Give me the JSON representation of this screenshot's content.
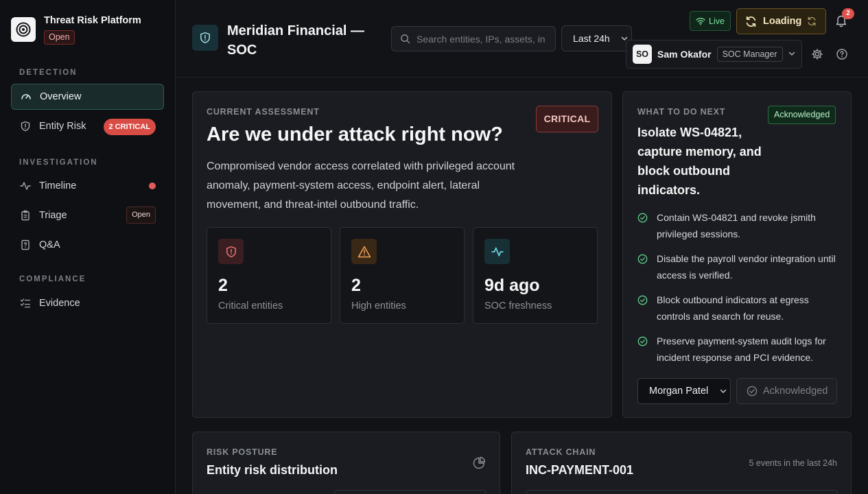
{
  "brand": {
    "title": "Threat Risk Platform",
    "status": "Open"
  },
  "sidebar": {
    "sections": [
      {
        "label": "DETECTION"
      },
      {
        "label": "INVESTIGATION"
      },
      {
        "label": "COMPLIANCE"
      }
    ],
    "items": [
      {
        "label": "Overview",
        "icon": "gauge-icon",
        "active": true
      },
      {
        "label": "Entity Risk",
        "icon": "shield-icon",
        "badge": "2 CRITICAL"
      },
      {
        "label": "Timeline",
        "icon": "activity-icon",
        "indicator": "red-dot"
      },
      {
        "label": "Triage",
        "icon": "clipboard-icon",
        "badge": "Open"
      },
      {
        "label": "Q&A",
        "icon": "question-file-icon"
      },
      {
        "label": "Evidence",
        "icon": "checklist-icon"
      }
    ]
  },
  "header": {
    "org_title": "Meridian Financial — SOC",
    "search_placeholder": "Search entities, IPs, assets, in",
    "time_range": "Last 24h",
    "live_label": "Live",
    "loading_label": "Loading",
    "notifications_count": "2",
    "user": {
      "initials": "SO",
      "name": "Sam Okafor",
      "role": "SOC Manager"
    }
  },
  "assessment": {
    "kicker": "CURRENT ASSESSMENT",
    "question": "Are we under attack right now?",
    "severity": "CRITICAL",
    "description": "Compromised vendor access correlated with privileged account anomaly, payment-system access, endpoint alert, lateral movement, and threat-intel outbound traffic.",
    "stats": [
      {
        "value": "2",
        "label": "Critical entities",
        "icon": "shield-alert-icon",
        "color": "#e07470"
      },
      {
        "value": "2",
        "label": "High entities",
        "icon": "warning-triangle-icon",
        "color": "#f0a35a"
      },
      {
        "value": "9d ago",
        "label": "SOC freshness",
        "icon": "activity-icon",
        "color": "#6fd0dc"
      }
    ]
  },
  "next_steps": {
    "kicker": "WHAT TO DO NEXT",
    "status": "Acknowledged",
    "headline": "Isolate WS-04821, capture memory, and block outbound indicators.",
    "steps": [
      "Contain WS-04821 and revoke jsmith privileged sessions.",
      "Disable the payroll vendor integration until access is verified.",
      "Block outbound indicators at egress controls and search for reuse.",
      "Preserve payment-system audit logs for incident response and PCI evidence."
    ],
    "assignee": "Morgan Patel",
    "ack_button": "Acknowledged"
  },
  "risk_posture": {
    "kicker": "RISK POSTURE",
    "title": "Entity risk distribution"
  },
  "attack_chain": {
    "kicker": "ATTACK CHAIN",
    "title": "INC-PAYMENT-001",
    "meta": "5 events in the last 24h"
  }
}
